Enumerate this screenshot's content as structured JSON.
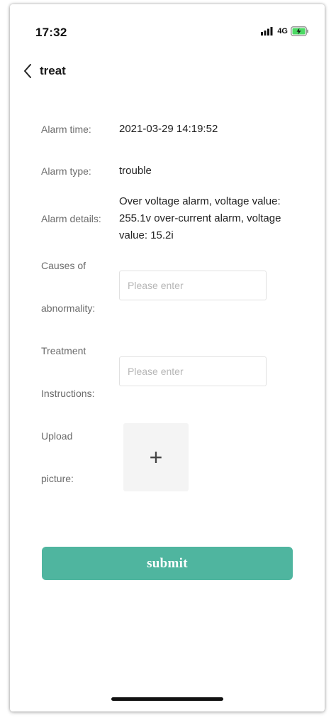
{
  "status_bar": {
    "time": "17:32",
    "network": "4G",
    "signal_icon": "signal-bars-icon",
    "battery_icon": "battery-charging-icon"
  },
  "nav": {
    "back_icon": "chevron-left-icon",
    "title": "treat"
  },
  "alarm": {
    "time_label": "Alarm time:",
    "time_value": "2021-03-29 14:19:52",
    "type_label": "Alarm type:",
    "type_value": "trouble",
    "details_label": "Alarm details:",
    "details_value": "Over voltage alarm, voltage value: 255.1v over-current alarm, voltage value: 15.2i"
  },
  "form": {
    "causes_label_line1": "Causes of",
    "causes_label_line2": "abnormality:",
    "causes_placeholder": "Please enter",
    "causes_value": "",
    "instructions_label_line1": "Treatment",
    "instructions_label_line2": "Instructions:",
    "instructions_placeholder": "Please enter",
    "instructions_value": "",
    "upload_label_line1": "Upload",
    "upload_label_line2": "picture:",
    "upload_icon": "plus-icon",
    "upload_glyph": "+"
  },
  "submit_label": "submit",
  "colors": {
    "accent": "#4fb59f",
    "label_text": "#6b6b6b",
    "value_text": "#222222",
    "upload_bg": "#f4f4f4"
  }
}
